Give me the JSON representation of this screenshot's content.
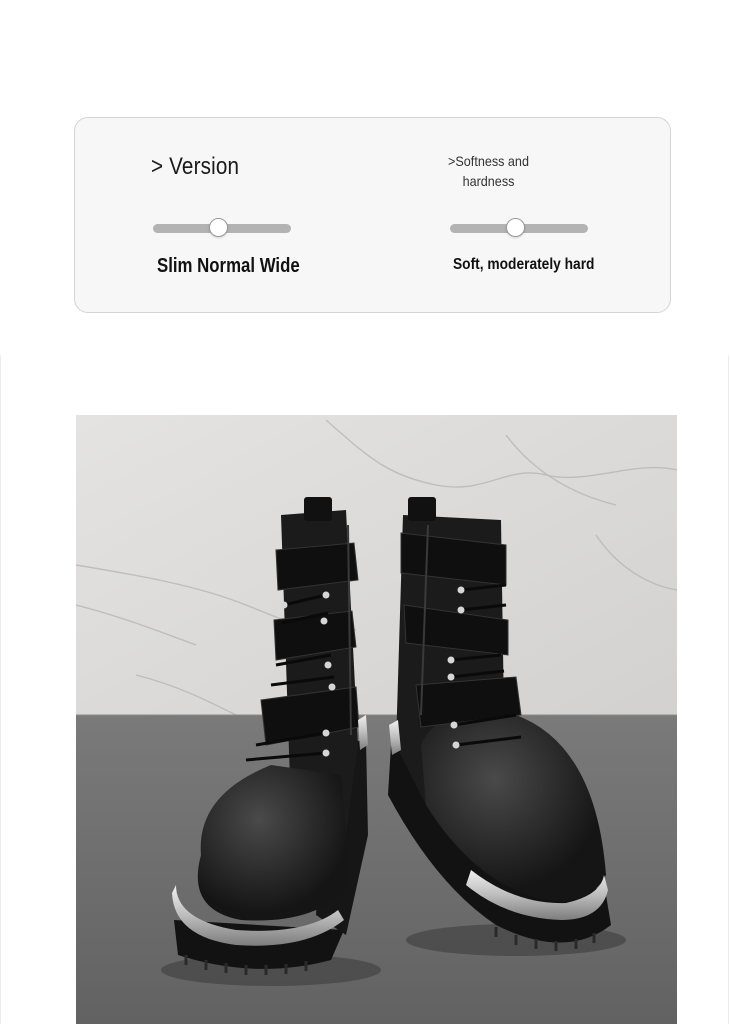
{
  "spec_card": {
    "version": {
      "title": "> Version",
      "value_label": "Slim Normal Wide",
      "slider_level": 0.48
    },
    "softness": {
      "title": ">Softness and hardness",
      "value_label": "Soft, moderately hard",
      "slider_level": 0.48
    }
  },
  "colors": {
    "card_background": "#f7f7f7",
    "card_border": "#d4d4d4",
    "slider_track": "#b3b3b3",
    "slider_thumb": "#ffffff",
    "floor": "#6e6e6e",
    "wall": "#dcdcdc",
    "boot_leather": "#1b1b1b",
    "toe_cap": "#c9c9c9"
  },
  "product_photo": {
    "subject": "black-leather-combat-boots"
  }
}
